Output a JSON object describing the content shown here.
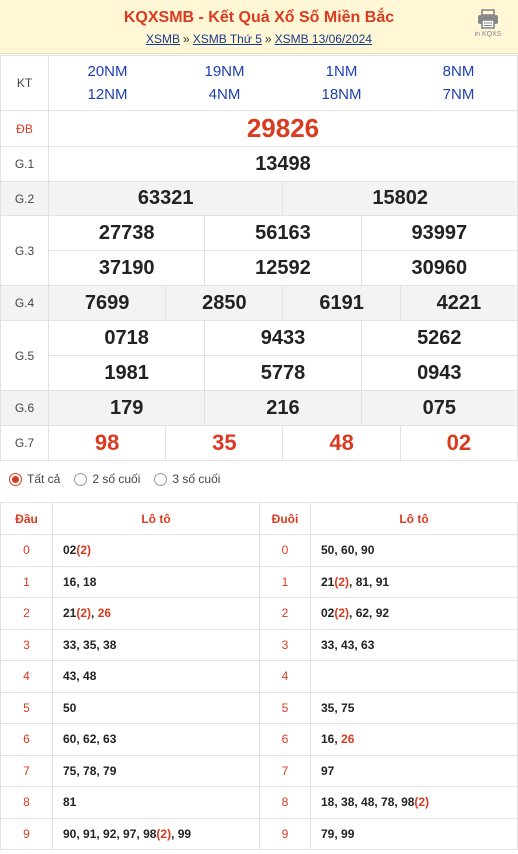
{
  "header": {
    "title": "KQXSMB - Kết Quả Xổ Số Miền Bắc",
    "crumbs": [
      "XSMB",
      "XSMB Thứ 5",
      "XSMB 13/06/2024"
    ],
    "crumb_sep": "»",
    "print_label": "in KQXS",
    "print_icon": "printer-icon"
  },
  "results": {
    "kt_label": "KT",
    "kt_codes": [
      [
        "20NM",
        "19NM",
        "1NM",
        "8NM"
      ],
      [
        "12NM",
        "4NM",
        "18NM",
        "7NM"
      ]
    ],
    "labels": {
      "db": "ĐB",
      "g1": "G.1",
      "g2": "G.2",
      "g3": "G.3",
      "g4": "G.4",
      "g5": "G.5",
      "g6": "G.6",
      "g7": "G.7"
    },
    "db": "29826",
    "g1": "13498",
    "g2": [
      "63321",
      "15802"
    ],
    "g3": [
      "27738",
      "56163",
      "93997",
      "37190",
      "12592",
      "30960"
    ],
    "g4": [
      "7699",
      "2850",
      "6191",
      "4221"
    ],
    "g5": [
      "0718",
      "9433",
      "5262",
      "1981",
      "5778",
      "0943"
    ],
    "g6": [
      "179",
      "216",
      "075"
    ],
    "g7": [
      "98",
      "35",
      "48",
      "02"
    ]
  },
  "options": {
    "all": "Tất cả",
    "two": "2 số cuối",
    "three": "3 số cuối",
    "selected": "all"
  },
  "loto": {
    "headers": {
      "dau": "Đầu",
      "loto": "Lô tô",
      "duoi": "Đuôi"
    },
    "rows": [
      {
        "dau": "0",
        "loto": [
          {
            "t": "02"
          },
          {
            "t": "(2)",
            "r": true
          }
        ],
        "duoi": "0",
        "loto2": [
          {
            "t": "50, 60, 90"
          }
        ]
      },
      {
        "dau": "1",
        "loto": [
          {
            "t": "16, 18"
          }
        ],
        "duoi": "1",
        "loto2": [
          {
            "t": "21"
          },
          {
            "t": "(2)",
            "r": true
          },
          {
            "t": ", 81, 91"
          }
        ]
      },
      {
        "dau": "2",
        "loto": [
          {
            "t": "21"
          },
          {
            "t": "(2)",
            "r": true
          },
          {
            "t": ", "
          },
          {
            "t": "26",
            "r": true
          }
        ],
        "duoi": "2",
        "loto2": [
          {
            "t": "02"
          },
          {
            "t": "(2)",
            "r": true
          },
          {
            "t": ", 62, 92"
          }
        ]
      },
      {
        "dau": "3",
        "loto": [
          {
            "t": "33, 35, 38"
          }
        ],
        "duoi": "3",
        "loto2": [
          {
            "t": "33, 43, 63"
          }
        ]
      },
      {
        "dau": "4",
        "loto": [
          {
            "t": "43, 48"
          }
        ],
        "duoi": "4",
        "loto2": []
      },
      {
        "dau": "5",
        "loto": [
          {
            "t": "50"
          }
        ],
        "duoi": "5",
        "loto2": [
          {
            "t": "35, 75"
          }
        ]
      },
      {
        "dau": "6",
        "loto": [
          {
            "t": "60, 62, 63"
          }
        ],
        "duoi": "6",
        "loto2": [
          {
            "t": "16, "
          },
          {
            "t": "26",
            "r": true
          }
        ]
      },
      {
        "dau": "7",
        "loto": [
          {
            "t": "75, 78, 79"
          }
        ],
        "duoi": "7",
        "loto2": [
          {
            "t": "97"
          }
        ]
      },
      {
        "dau": "8",
        "loto": [
          {
            "t": "81"
          }
        ],
        "duoi": "8",
        "loto2": [
          {
            "t": "18, 38, 48, 78, 98"
          },
          {
            "t": "(2)",
            "r": true
          }
        ]
      },
      {
        "dau": "9",
        "loto": [
          {
            "t": "90, 91, 92, 97, 98"
          },
          {
            "t": "(2)",
            "r": true
          },
          {
            "t": ", 99"
          }
        ],
        "duoi": "9",
        "loto2": [
          {
            "t": "79, 99"
          }
        ]
      }
    ]
  },
  "colors": {
    "accent": "#d93a20",
    "link": "#1a3a8a",
    "code": "#1f3fb0",
    "header_bg": "#fff7d6",
    "shade": "#f3f3f3"
  }
}
